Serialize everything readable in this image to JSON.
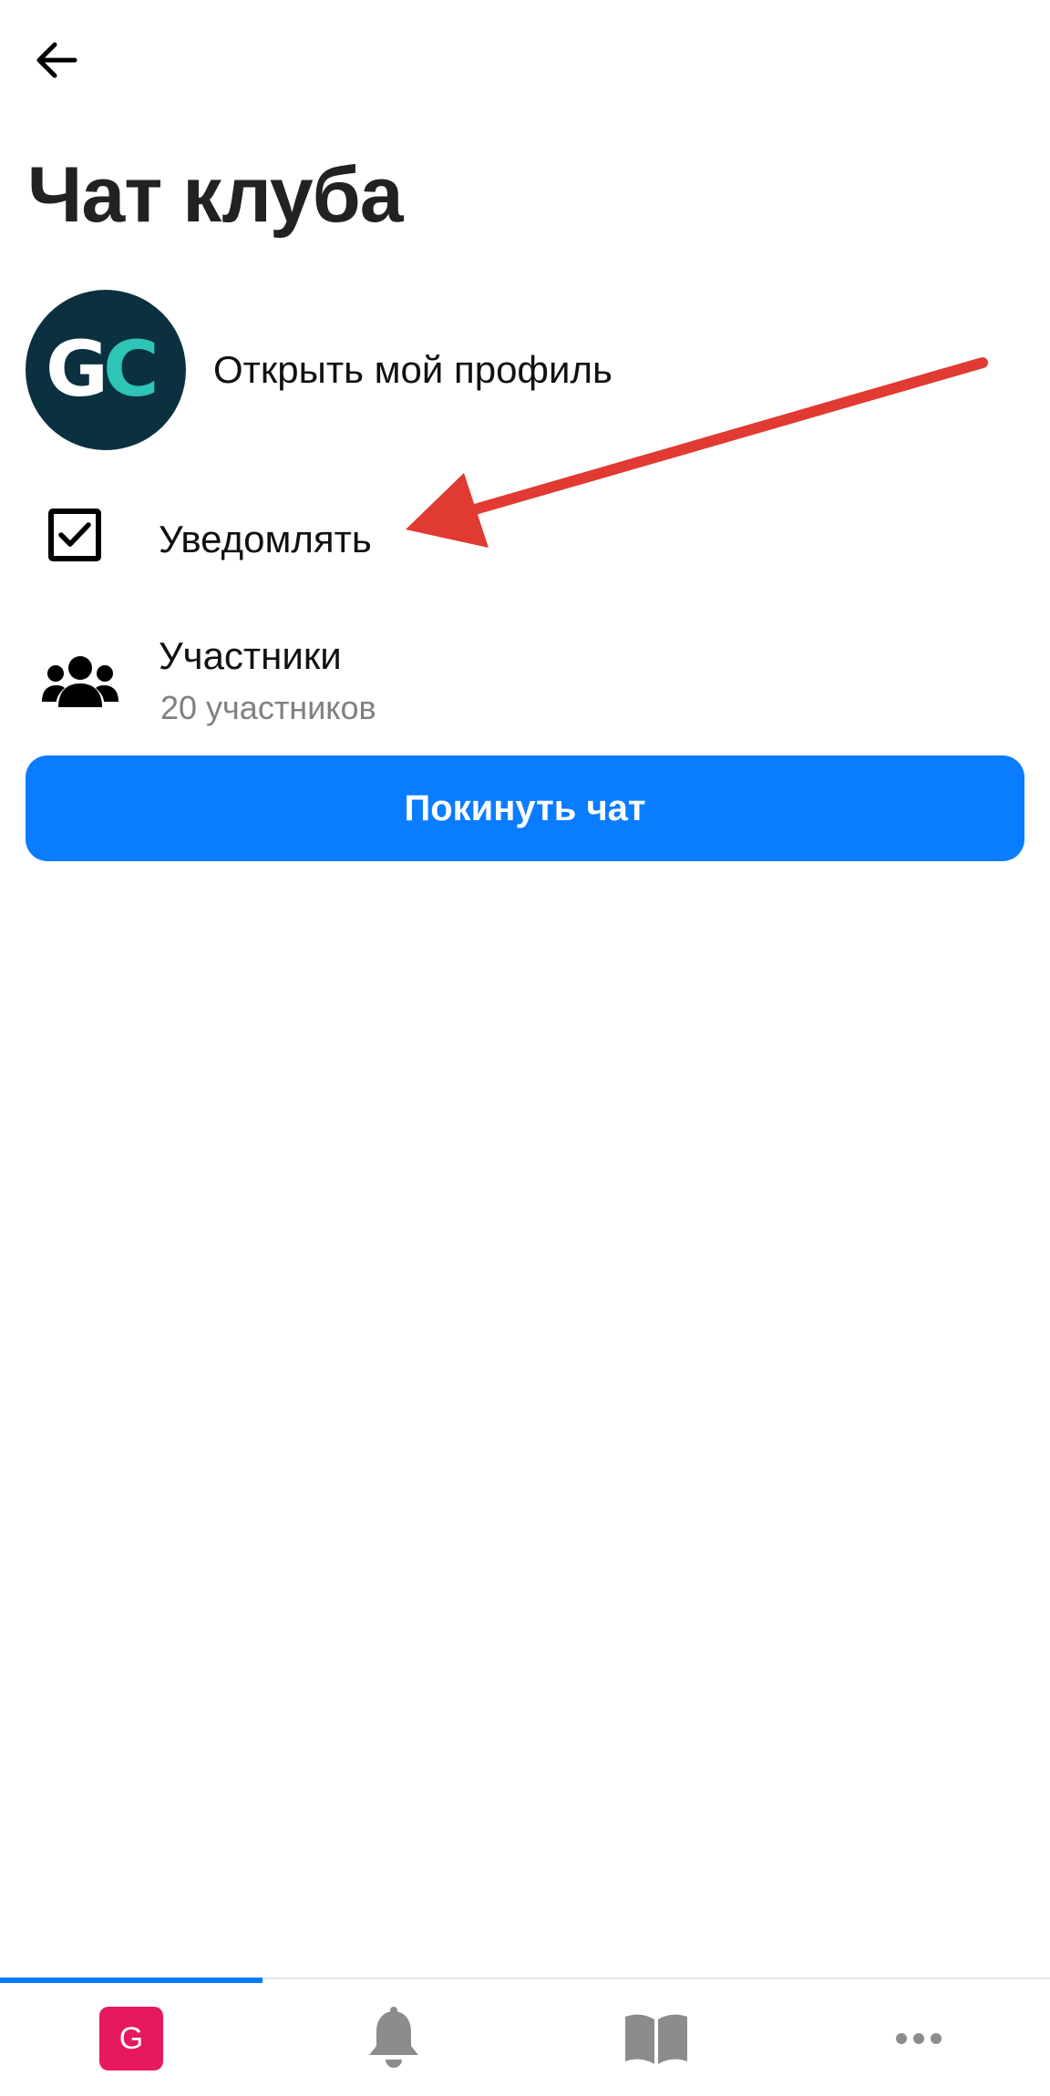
{
  "header": {
    "back_icon": "arrow-left-icon",
    "title": "Чат клуба"
  },
  "profile": {
    "avatar_text_first": "G",
    "avatar_text_second": "C",
    "avatar_bg": "#0b3140",
    "avatar_accent": "#2ec4b6",
    "label": "Открыть мой профиль"
  },
  "notify": {
    "label": "Уведомлять",
    "checked": true,
    "icon": "checkbox-checked-icon"
  },
  "members": {
    "icon": "group-icon",
    "label": "Участники",
    "count_text": "20 участников"
  },
  "leave_button": {
    "label": "Покинуть чат",
    "color": "#0a7cff"
  },
  "annotation": {
    "icon": "red-arrow-annotation",
    "color": "#e03a32"
  },
  "tabbar": {
    "tabs": [
      {
        "name": "club",
        "icon": "club-badge-icon",
        "badge_text": "G",
        "badge_color": "#e8185c",
        "active": true
      },
      {
        "name": "notifications",
        "icon": "bell-icon",
        "active": false
      },
      {
        "name": "library",
        "icon": "book-icon",
        "active": false
      },
      {
        "name": "more",
        "icon": "more-dots-icon",
        "active": false
      }
    ],
    "active_color": "#0a7cff",
    "inactive_color": "#8c8c8c"
  }
}
